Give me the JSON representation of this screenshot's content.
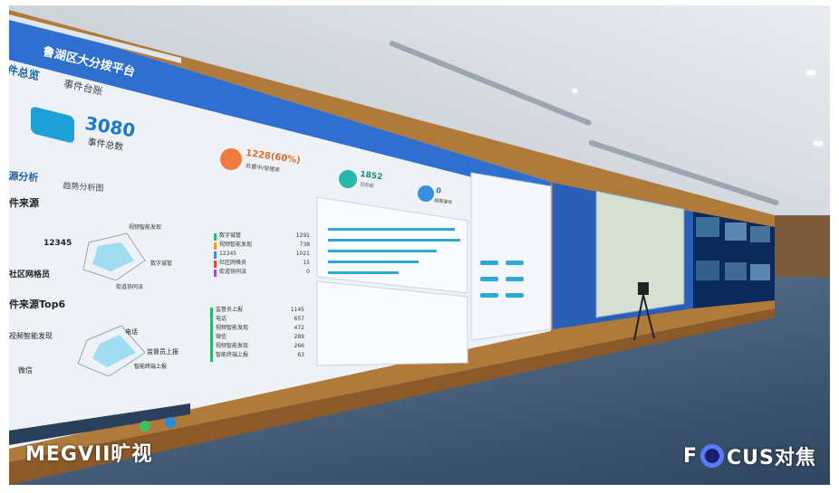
{
  "platform": {
    "title": "鲁湖区大分拨平台",
    "tabs": [
      "件总览",
      "事件台账"
    ]
  },
  "stats": {
    "total_value": "3080",
    "total_label": "事件总数",
    "stat2_value": "1228(60%)",
    "stat2_label": "处置中/受理率",
    "stat3_value": "1852",
    "stat3_label": "已办结",
    "stat4_value": "0",
    "stat4_label": "超期事件"
  },
  "analysis": {
    "tabs": [
      "源分析",
      "趋势分析图"
    ],
    "section1_title": "件来源",
    "section2_title": "件来源Top6",
    "radar1_labels": [
      "12345",
      "视频智能发现",
      "数字城管",
      "社区网格员",
      "街道协同派"
    ],
    "radar2_labels": [
      "视频智能发现",
      "电话",
      "微信",
      "监督员上报",
      "智能终端上报"
    ],
    "list1": [
      {
        "label": "数字城管",
        "value": "1291"
      },
      {
        "label": "视频智能发现",
        "value": "738"
      },
      {
        "label": "12345",
        "value": "1021"
      },
      {
        "label": "社区网格员",
        "value": "15"
      },
      {
        "label": "街道协同派",
        "value": "0"
      }
    ],
    "list2": [
      {
        "label": "监督员上报",
        "value": "1145"
      },
      {
        "label": "电话",
        "value": "657"
      },
      {
        "label": "视频智能发现",
        "value": "472"
      },
      {
        "label": "微信",
        "value": "289"
      },
      {
        "label": "视频智能发现",
        "value": "266"
      },
      {
        "label": "智能终端上报",
        "value": "63"
      }
    ]
  },
  "watermarks": {
    "left": "MEGVII旷视",
    "right_prefix": "F",
    "right_suffix": "CUS对焦"
  }
}
